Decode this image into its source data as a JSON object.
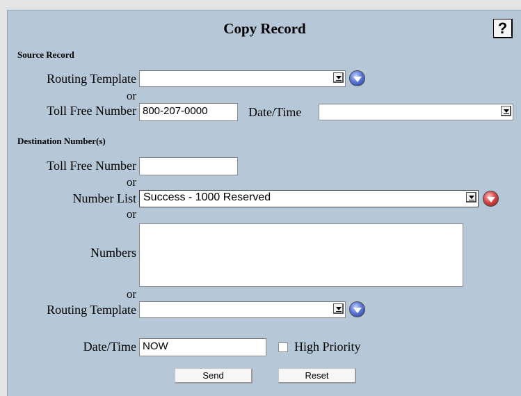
{
  "form": {
    "title": "Copy Record",
    "help_label": "?"
  },
  "source": {
    "section_title": "Source Record",
    "routing_template_label": "Routing Template",
    "routing_template_value": "",
    "or_1": "or",
    "toll_free_label": "Toll Free Number",
    "toll_free_value": "800-207-0000",
    "datetime_label": "Date/Time",
    "datetime_value": ""
  },
  "destination": {
    "section_title": "Destination Number(s)",
    "toll_free_label": "Toll Free Number",
    "toll_free_value": "",
    "or_1": "or",
    "number_list_label": "Number List",
    "number_list_value": "Success - 1000 Reserved",
    "or_2": "or",
    "numbers_label": "Numbers",
    "numbers_value": "",
    "or_3": "or",
    "routing_template_label": "Routing Template",
    "routing_template_value": ""
  },
  "footer": {
    "datetime_label": "Date/Time",
    "datetime_value": "NOW",
    "high_priority_label": "High Priority",
    "high_priority_checked": false,
    "send_label": "Send",
    "reset_label": "Reset"
  },
  "icons": {
    "source_template_orb": "blue-dropdown-orb-icon",
    "number_list_orb": "red-dropdown-orb-icon",
    "dest_template_orb": "blue-dropdown-orb-icon"
  },
  "colors": {
    "panel_background": "#b6c8d8",
    "page_background": "#e4e4e4",
    "blue_orb": "#5d78d9",
    "red_orb": "#d64848"
  }
}
